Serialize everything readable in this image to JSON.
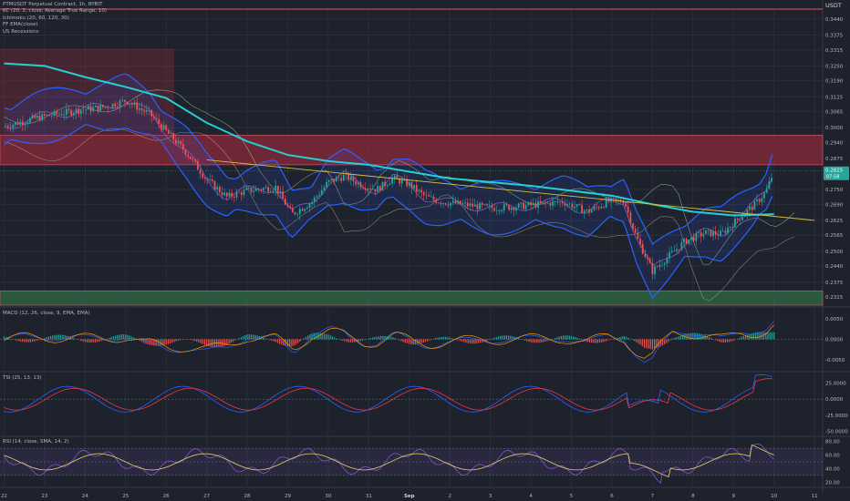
{
  "header": {
    "title": "PTMUSDT Perpetual Contract, 1h, BYBIT",
    "indicators": [
      "KC (20, 2, close, Average True Range, 10)",
      "Ichimoku (20, 60, 120, 30)",
      "FF EMA(close)",
      "US Recessions"
    ]
  },
  "axis_label": "USDT",
  "price_axis": {
    "ticks": [
      "0.3440",
      "0.3375",
      "0.3315",
      "0.3250",
      "0.3190",
      "0.3125",
      "0.3065",
      "0.3000",
      "0.2940",
      "0.2875",
      "0.2750",
      "0.2690",
      "0.2625",
      "0.2565",
      "0.2500",
      "0.2440",
      "0.2375",
      "0.2315"
    ],
    "last_price": "0.2825",
    "countdown": "07:58"
  },
  "macd_pane": {
    "label": "MACD (12, 26, close, 9, EMA, EMA)",
    "ticks": [
      "0.0050",
      "0.0000",
      "-0.0050"
    ]
  },
  "tsi_pane": {
    "label": "TSI (25, 13, 13)",
    "ticks": [
      "25.0000",
      "0.0000",
      "-25.0000",
      "-50.0000"
    ]
  },
  "rsi_pane": {
    "label": "RSI (14, close, SMA, 14, 2)",
    "ticks": [
      "80.00",
      "60.00",
      "40.00",
      "20.00"
    ]
  },
  "time_axis": {
    "ticks": [
      "22",
      "23",
      "24",
      "25",
      "26",
      "27",
      "28",
      "29",
      "30",
      "31",
      "Sep",
      "2",
      "3",
      "4",
      "5",
      "6",
      "7",
      "8",
      "9",
      "10",
      "11"
    ]
  },
  "colors": {
    "background": "#1e222d",
    "candle_up": "#26a69a",
    "candle_down": "#ef5350",
    "ema": "#26d0ce",
    "keltner": "#2962ff",
    "resistance_zone": "#8b2a3a",
    "support_zone": "#2e6b46",
    "trendline": "#d4c33d"
  },
  "chart_data": {
    "type": "candlestick",
    "title": "PTMUSDT Perpetual Contract, 1h, BYBIT",
    "xlabel": "",
    "ylabel": "USDT",
    "ylim": [
      0.2282,
      0.348
    ],
    "x_range_days": [
      21.9,
      42.2
    ],
    "price_path": [
      [
        22.0,
        0.3005
      ],
      [
        22.8,
        0.304
      ],
      [
        23.8,
        0.307
      ],
      [
        24.5,
        0.3085
      ],
      [
        25.0,
        0.311
      ],
      [
        25.6,
        0.3055
      ],
      [
        26.0,
        0.2985
      ],
      [
        26.5,
        0.29
      ],
      [
        27.0,
        0.279
      ],
      [
        27.5,
        0.272
      ],
      [
        28.0,
        0.2745
      ],
      [
        28.7,
        0.276
      ],
      [
        29.1,
        0.265
      ],
      [
        29.6,
        0.27
      ],
      [
        30.0,
        0.278
      ],
      [
        30.4,
        0.2805
      ],
      [
        30.8,
        0.277
      ],
      [
        31.2,
        0.275
      ],
      [
        31.6,
        0.2795
      ],
      [
        32.0,
        0.277
      ],
      [
        32.4,
        0.272
      ],
      [
        32.8,
        0.27
      ],
      [
        33.3,
        0.269
      ],
      [
        34.0,
        0.2675
      ],
      [
        34.6,
        0.268
      ],
      [
        35.2,
        0.269
      ],
      [
        35.8,
        0.27
      ],
      [
        36.4,
        0.266
      ],
      [
        36.9,
        0.27
      ],
      [
        37.3,
        0.2705
      ],
      [
        37.6,
        0.256
      ],
      [
        38.0,
        0.242
      ],
      [
        38.4,
        0.248
      ],
      [
        38.8,
        0.254
      ],
      [
        39.3,
        0.2575
      ],
      [
        39.7,
        0.257
      ],
      [
        40.1,
        0.263
      ],
      [
        40.5,
        0.2685
      ],
      [
        40.8,
        0.274
      ],
      [
        41.0,
        0.2825
      ]
    ],
    "ema_path": [
      [
        22.0,
        0.326
      ],
      [
        23.0,
        0.325
      ],
      [
        24.0,
        0.3205
      ],
      [
        25.0,
        0.3165
      ],
      [
        26.0,
        0.312
      ],
      [
        27.0,
        0.302
      ],
      [
        28.0,
        0.2945
      ],
      [
        29.0,
        0.289
      ],
      [
        30.0,
        0.2865
      ],
      [
        31.0,
        0.285
      ],
      [
        32.0,
        0.2822
      ],
      [
        33.0,
        0.2795
      ],
      [
        34.0,
        0.278
      ],
      [
        35.0,
        0.2765
      ],
      [
        36.0,
        0.2745
      ],
      [
        37.0,
        0.2725
      ],
      [
        38.0,
        0.269
      ],
      [
        39.0,
        0.266
      ],
      [
        40.0,
        0.2645
      ],
      [
        41.0,
        0.265
      ]
    ],
    "trendline": [
      [
        27.0,
        0.287
      ],
      [
        42.0,
        0.2625
      ]
    ],
    "zones": [
      {
        "name": "resistance",
        "low": 0.285,
        "high": 0.297
      },
      {
        "name": "upper",
        "low": 0.297,
        "high": 0.332
      },
      {
        "name": "support",
        "low": 0.2282,
        "high": 0.234
      }
    ],
    "horizontal_line": 0.348,
    "last_price": 0.2825,
    "macd_ylim": [
      -0.0075,
      0.0075
    ],
    "tsi_ylim": [
      -55,
      40
    ],
    "rsi_ylim": [
      15,
      85
    ]
  }
}
